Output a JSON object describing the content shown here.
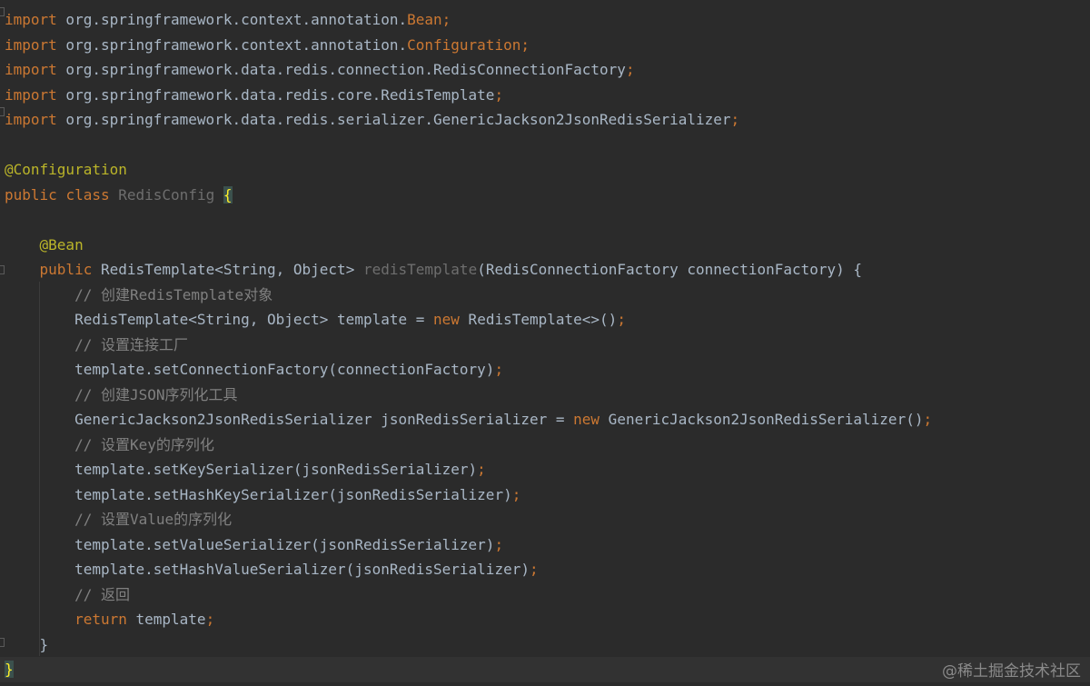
{
  "editor": {
    "imports": [
      {
        "kw": "import",
        "pkg": " org.springframework.context.annotation.",
        "cls": "Bean",
        "end": ";"
      },
      {
        "kw": "import",
        "pkg": " org.springframework.context.annotation.",
        "cls": "Configuration",
        "end": ";"
      },
      {
        "kw": "import",
        "pkg": " org.springframework.data.redis.connection.RedisConnectionFactory",
        "cls": "",
        "end": ";"
      },
      {
        "kw": "import",
        "pkg": " org.springframework.data.redis.core.RedisTemplate",
        "cls": "",
        "end": ";"
      },
      {
        "kw": "import",
        "pkg": " org.springframework.data.redis.serializer.GenericJackson2JsonRedisSerializer",
        "cls": "",
        "end": ";"
      }
    ],
    "class_annotation": "@Configuration",
    "class_public": "public",
    "class_kw": "class",
    "class_name": "RedisConfig",
    "open_brace": "{",
    "method_annotation": "@Bean",
    "method_public": "public",
    "method_return": "RedisTemplate<String, Object>",
    "method_name": "redisTemplate",
    "method_params": "(RedisConnectionFactory connectionFactory) {",
    "comment1": "// 创建RedisTemplate对象",
    "line_template_a": "RedisTemplate<String, Object> template = ",
    "kw_new": "new",
    "line_template_b": " RedisTemplate<>()",
    "semicolon": ";",
    "comment2": "// 设置连接工厂",
    "line_setcf": "template.setConnectionFactory(connectionFactory)",
    "comment3": "// 创建JSON序列化工具",
    "line_json_a": "GenericJackson2JsonRedisSerializer jsonRedisSerializer = ",
    "line_json_b": " GenericJackson2JsonRedisSerializer()",
    "comment4": "// 设置Key的序列化",
    "line_setkey": "template.setKeySerializer(jsonRedisSerializer)",
    "line_sethashkey": "template.setHashKeySerializer(jsonRedisSerializer)",
    "comment5": "// 设置Value的序列化",
    "line_setvalue": "template.setValueSerializer(jsonRedisSerializer)",
    "line_sethashvalue": "template.setHashValueSerializer(jsonRedisSerializer)",
    "comment6": "// 返回",
    "kw_return": "return",
    "line_return": " template",
    "method_close": "}",
    "class_close": "}"
  },
  "watermark": "@稀土掘金技术社区",
  "colors": {
    "background": "#2b2b2b",
    "keyword": "#cc7832",
    "annotation": "#bbb529",
    "comment": "#808080",
    "text": "#a9b7c6"
  }
}
